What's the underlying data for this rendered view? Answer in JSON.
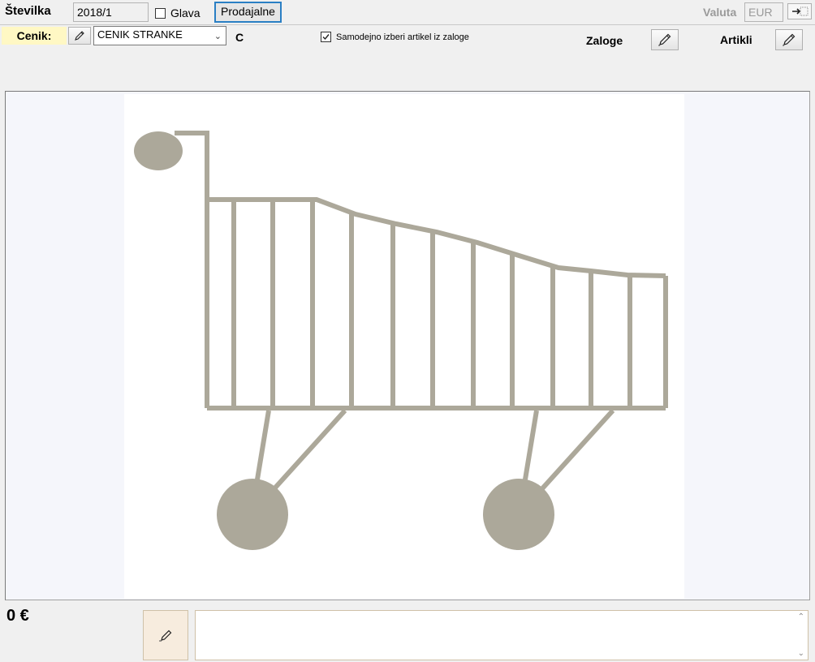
{
  "header": {
    "stevilka_label": "Številka",
    "stevilka_value": "2018/1",
    "glava_label": "Glava",
    "prodajalne_label": "Prodajalne",
    "valuta_label": "Valuta",
    "valuta_value": "EUR"
  },
  "toolbar": {
    "cenik_label": "Cenik:",
    "cenik_selected": "CENIK STRANKE",
    "cenik_code": "C",
    "auto_select_label": "Samodejno izberi artikel iz zaloge",
    "auto_select_checked": true,
    "zaloge_label": "Zaloge",
    "artikli_label": "Artikli"
  },
  "picture": {
    "icon": "shopping-cart-icon",
    "cart_color": "#aca89a"
  },
  "footer": {
    "total": "0 €"
  }
}
